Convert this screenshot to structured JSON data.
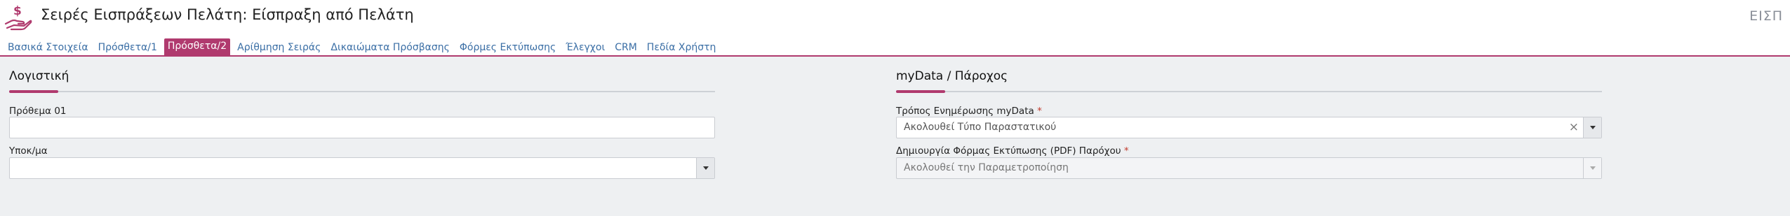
{
  "header": {
    "title": "Σειρές Εισπράξεων Πελάτη: Είσπραξη από Πελάτη",
    "code": "ΕΙΣΠ",
    "icon": "hand-money-icon",
    "accent_color": "#b03a6e"
  },
  "tabs": [
    {
      "label": "Βασικά Στοιχεία",
      "active": false
    },
    {
      "label": "Πρόσθετα/1",
      "active": false
    },
    {
      "label": "Πρόσθετα/2",
      "active": true
    },
    {
      "label": "Αρίθμηση Σειράς",
      "active": false
    },
    {
      "label": "Δικαιώματα Πρόσβασης",
      "active": false
    },
    {
      "label": "Φόρμες Εκτύπωσης",
      "active": false
    },
    {
      "label": "Έλεγχοι",
      "active": false
    },
    {
      "label": "CRM",
      "active": false
    },
    {
      "label": "Πεδία Χρήστη",
      "active": false
    }
  ],
  "left_section": {
    "title": "Λογιστική",
    "prothema_label": "Πρόθεμα 01",
    "prothema_value": "",
    "ypokm_label": "Υποκ/μα",
    "ypokm_value": ""
  },
  "right_section": {
    "title": "myData / Πάροχος",
    "mydata_label": "Τρόπος Ενημέρωσης myData",
    "mydata_value": "Ακολουθεί Τύπο Παραστατικού",
    "pdf_label": "Δημιουργία Φόρμας Εκτύπωσης (PDF) Παρόχου",
    "pdf_value": "Ακολουθεί την Παραμετροποίηση",
    "required_mark": "*"
  }
}
